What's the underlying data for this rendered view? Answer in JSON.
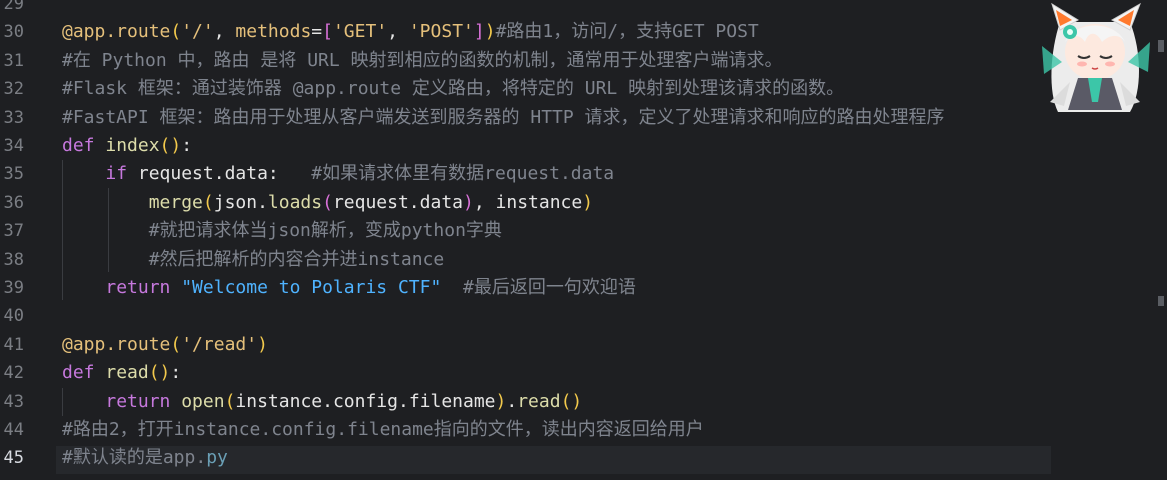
{
  "editor": {
    "lines": [
      {
        "n": "29",
        "parts": []
      },
      {
        "n": "30",
        "parts": [
          {
            "c": "dec",
            "t": "@app.route"
          },
          {
            "c": "br1",
            "t": "("
          },
          {
            "c": "str",
            "t": "'/'"
          },
          {
            "c": "var",
            "t": ", "
          },
          {
            "c": "dec",
            "t": "methods"
          },
          {
            "c": "var",
            "t": "="
          },
          {
            "c": "br2",
            "t": "["
          },
          {
            "c": "str",
            "t": "'GET'"
          },
          {
            "c": "var",
            "t": ", "
          },
          {
            "c": "str",
            "t": "'POST'"
          },
          {
            "c": "br2",
            "t": "]"
          },
          {
            "c": "br1",
            "t": ")"
          },
          {
            "c": "cm",
            "t": "#路由1，访问/，支持GET POST"
          }
        ]
      },
      {
        "n": "31",
        "parts": [
          {
            "c": "cm",
            "t": "#在 Python 中，路由 是将 URL 映射到相应的函数的机制，通常用于处理客户端请求。"
          }
        ]
      },
      {
        "n": "32",
        "parts": [
          {
            "c": "cm",
            "t": "#Flask 框架：通过装饰器 @app.route 定义路由，将特定的 URL 映射到处理该请求的函数。"
          }
        ]
      },
      {
        "n": "33",
        "parts": [
          {
            "c": "cm",
            "t": "#FastAPI 框架：路由用于处理从客户端发送到服务器的 HTTP 请求，定义了处理请求和响应的路由处理程序"
          }
        ]
      },
      {
        "n": "34",
        "parts": [
          {
            "c": "kw",
            "t": "def "
          },
          {
            "c": "name",
            "t": "index"
          },
          {
            "c": "br1",
            "t": "()"
          },
          {
            "c": "var",
            "t": ":"
          }
        ]
      },
      {
        "n": "35",
        "parts": [
          {
            "c": "var",
            "t": "    "
          },
          {
            "c": "kw",
            "t": "if "
          },
          {
            "c": "var",
            "t": "request.data:   "
          },
          {
            "c": "cm",
            "t": "#如果请求体里有数据request.data"
          }
        ]
      },
      {
        "n": "36",
        "parts": [
          {
            "c": "var",
            "t": "        "
          },
          {
            "c": "name",
            "t": "merge"
          },
          {
            "c": "br1",
            "t": "("
          },
          {
            "c": "var",
            "t": "json."
          },
          {
            "c": "name",
            "t": "loads"
          },
          {
            "c": "br2",
            "t": "("
          },
          {
            "c": "var",
            "t": "request.data"
          },
          {
            "c": "br2",
            "t": ")"
          },
          {
            "c": "var",
            "t": ", instance"
          },
          {
            "c": "br1",
            "t": ")"
          }
        ]
      },
      {
        "n": "37",
        "parts": [
          {
            "c": "var",
            "t": "        "
          },
          {
            "c": "cm",
            "t": "#就把请求体当json解析，变成python字典"
          }
        ]
      },
      {
        "n": "38",
        "parts": [
          {
            "c": "var",
            "t": "        "
          },
          {
            "c": "cm",
            "t": "#然后把解析的内容合并进instance"
          }
        ]
      },
      {
        "n": "39",
        "parts": [
          {
            "c": "var",
            "t": "    "
          },
          {
            "c": "kw",
            "t": "return "
          },
          {
            "c": "sq",
            "t": "\"Welcome to Polaris CTF\""
          },
          {
            "c": "var",
            "t": "  "
          },
          {
            "c": "cm",
            "t": "#最后返回一句欢迎语"
          }
        ]
      },
      {
        "n": "40",
        "parts": []
      },
      {
        "n": "41",
        "parts": [
          {
            "c": "dec",
            "t": "@app.route"
          },
          {
            "c": "br1",
            "t": "("
          },
          {
            "c": "str",
            "t": "'/read'"
          },
          {
            "c": "br1",
            "t": ")"
          }
        ]
      },
      {
        "n": "42",
        "parts": [
          {
            "c": "kw",
            "t": "def "
          },
          {
            "c": "name",
            "t": "read"
          },
          {
            "c": "br1",
            "t": "()"
          },
          {
            "c": "var",
            "t": ":"
          }
        ]
      },
      {
        "n": "43",
        "parts": [
          {
            "c": "var",
            "t": "    "
          },
          {
            "c": "kw",
            "t": "return "
          },
          {
            "c": "name",
            "t": "open"
          },
          {
            "c": "br1",
            "t": "("
          },
          {
            "c": "var",
            "t": "instance.config.filename"
          },
          {
            "c": "br1",
            "t": ")"
          },
          {
            "c": "var",
            "t": "."
          },
          {
            "c": "name",
            "t": "read"
          },
          {
            "c": "br1",
            "t": "()"
          }
        ]
      },
      {
        "n": "44",
        "parts": [
          {
            "c": "cm",
            "t": "#路由2，打开instance.config.filename指向的文件，读出内容返回给用户"
          }
        ]
      },
      {
        "n": "45",
        "parts": [
          {
            "c": "cm",
            "t": "#默认读的是app."
          },
          {
            "c": "str-py",
            "t": "py"
          }
        ]
      }
    ],
    "current_line": "45"
  }
}
